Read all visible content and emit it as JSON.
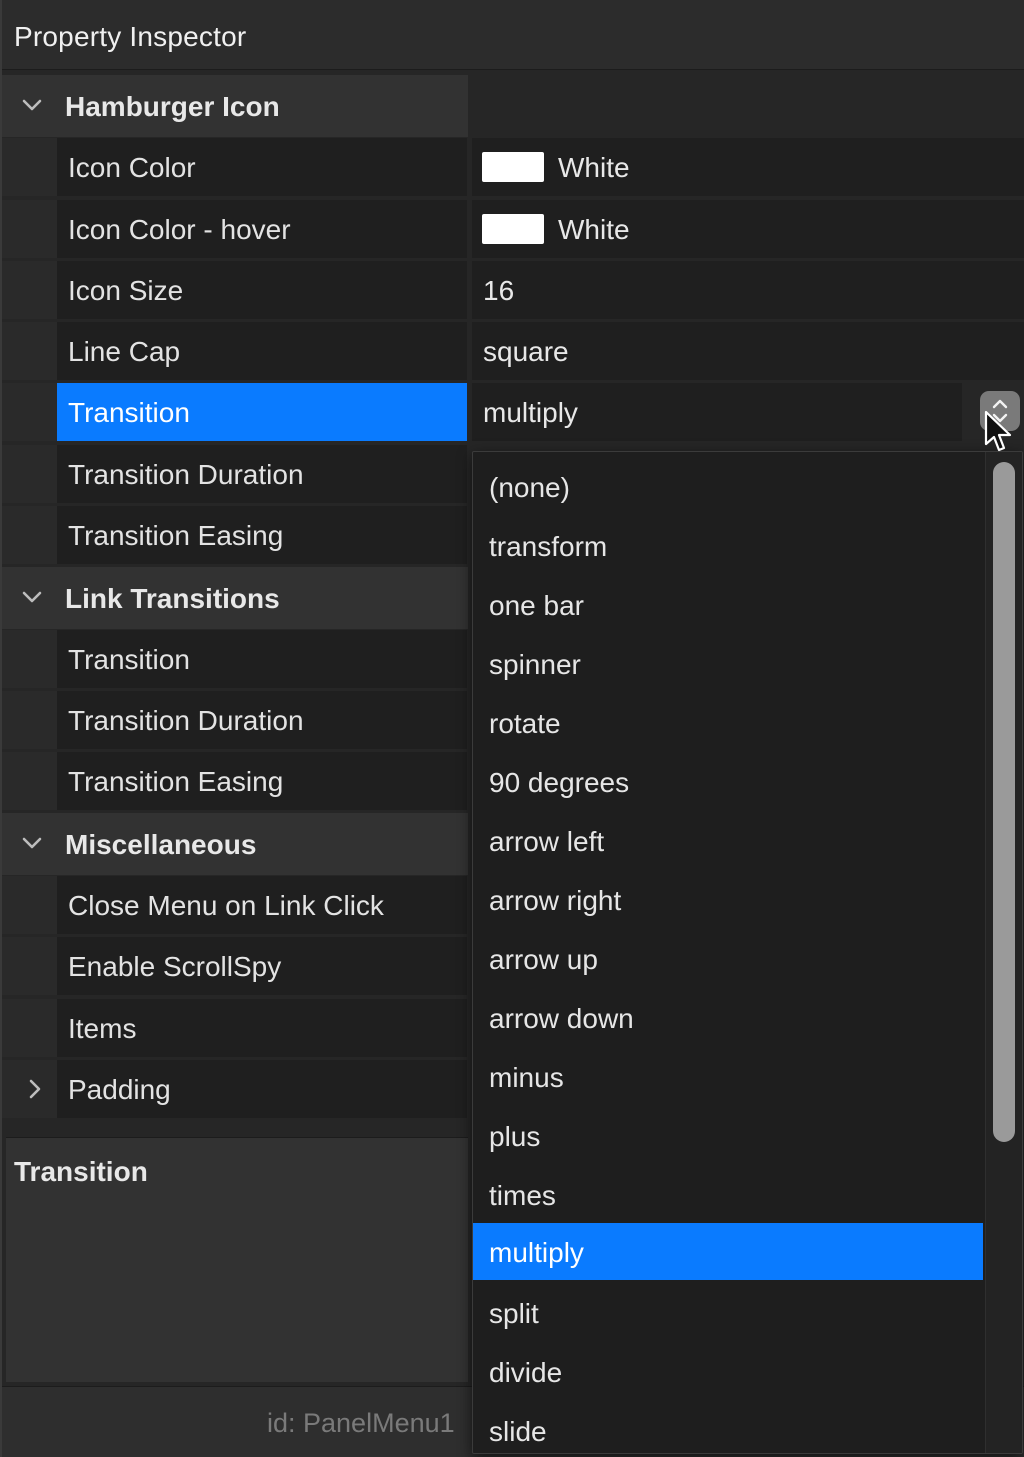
{
  "window": {
    "title": "Property Inspector"
  },
  "sections": [
    {
      "title": "Hamburger Icon",
      "rows": [
        {
          "label": "Icon Color",
          "value": "White",
          "swatch": "#ffffff"
        },
        {
          "label": "Icon Color - hover",
          "value": "White",
          "swatch": "#ffffff"
        },
        {
          "label": "Icon Size",
          "value": "16"
        },
        {
          "label": "Line Cap",
          "value": "square"
        },
        {
          "label": "Transition",
          "value": "multiply",
          "selected": true
        },
        {
          "label": "Transition Duration"
        },
        {
          "label": "Transition Easing"
        }
      ]
    },
    {
      "title": "Link Transitions",
      "rows": [
        {
          "label": "Transition"
        },
        {
          "label": "Transition Duration"
        },
        {
          "label": "Transition Easing"
        }
      ]
    },
    {
      "title": "Miscellaneous",
      "rows": [
        {
          "label": "Close Menu on Link Click"
        },
        {
          "label": "Enable ScrollSpy"
        },
        {
          "label": "Items"
        },
        {
          "label": "Padding",
          "expandable": true
        }
      ]
    }
  ],
  "description": {
    "title": "Transition"
  },
  "footer": {
    "id_text": "id: PanelMenu1"
  },
  "dropdown": {
    "options": [
      "(none)",
      "transform",
      "one bar",
      "spinner",
      "rotate",
      "90 degrees",
      "arrow left",
      "arrow right",
      "arrow up",
      "arrow down",
      "minus",
      "plus",
      "times",
      "multiply",
      "split",
      "divide",
      "slide"
    ],
    "selected": "multiply"
  },
  "colors": {
    "accent": "#0a7bff",
    "swatch_white": "#ffffff"
  },
  "icons": {
    "section_toggle": "chevron-down-icon",
    "row_expand": "chevron-right-icon",
    "stepper": "up-down-stepper-icon",
    "cursor": "mouse-pointer-icon"
  }
}
